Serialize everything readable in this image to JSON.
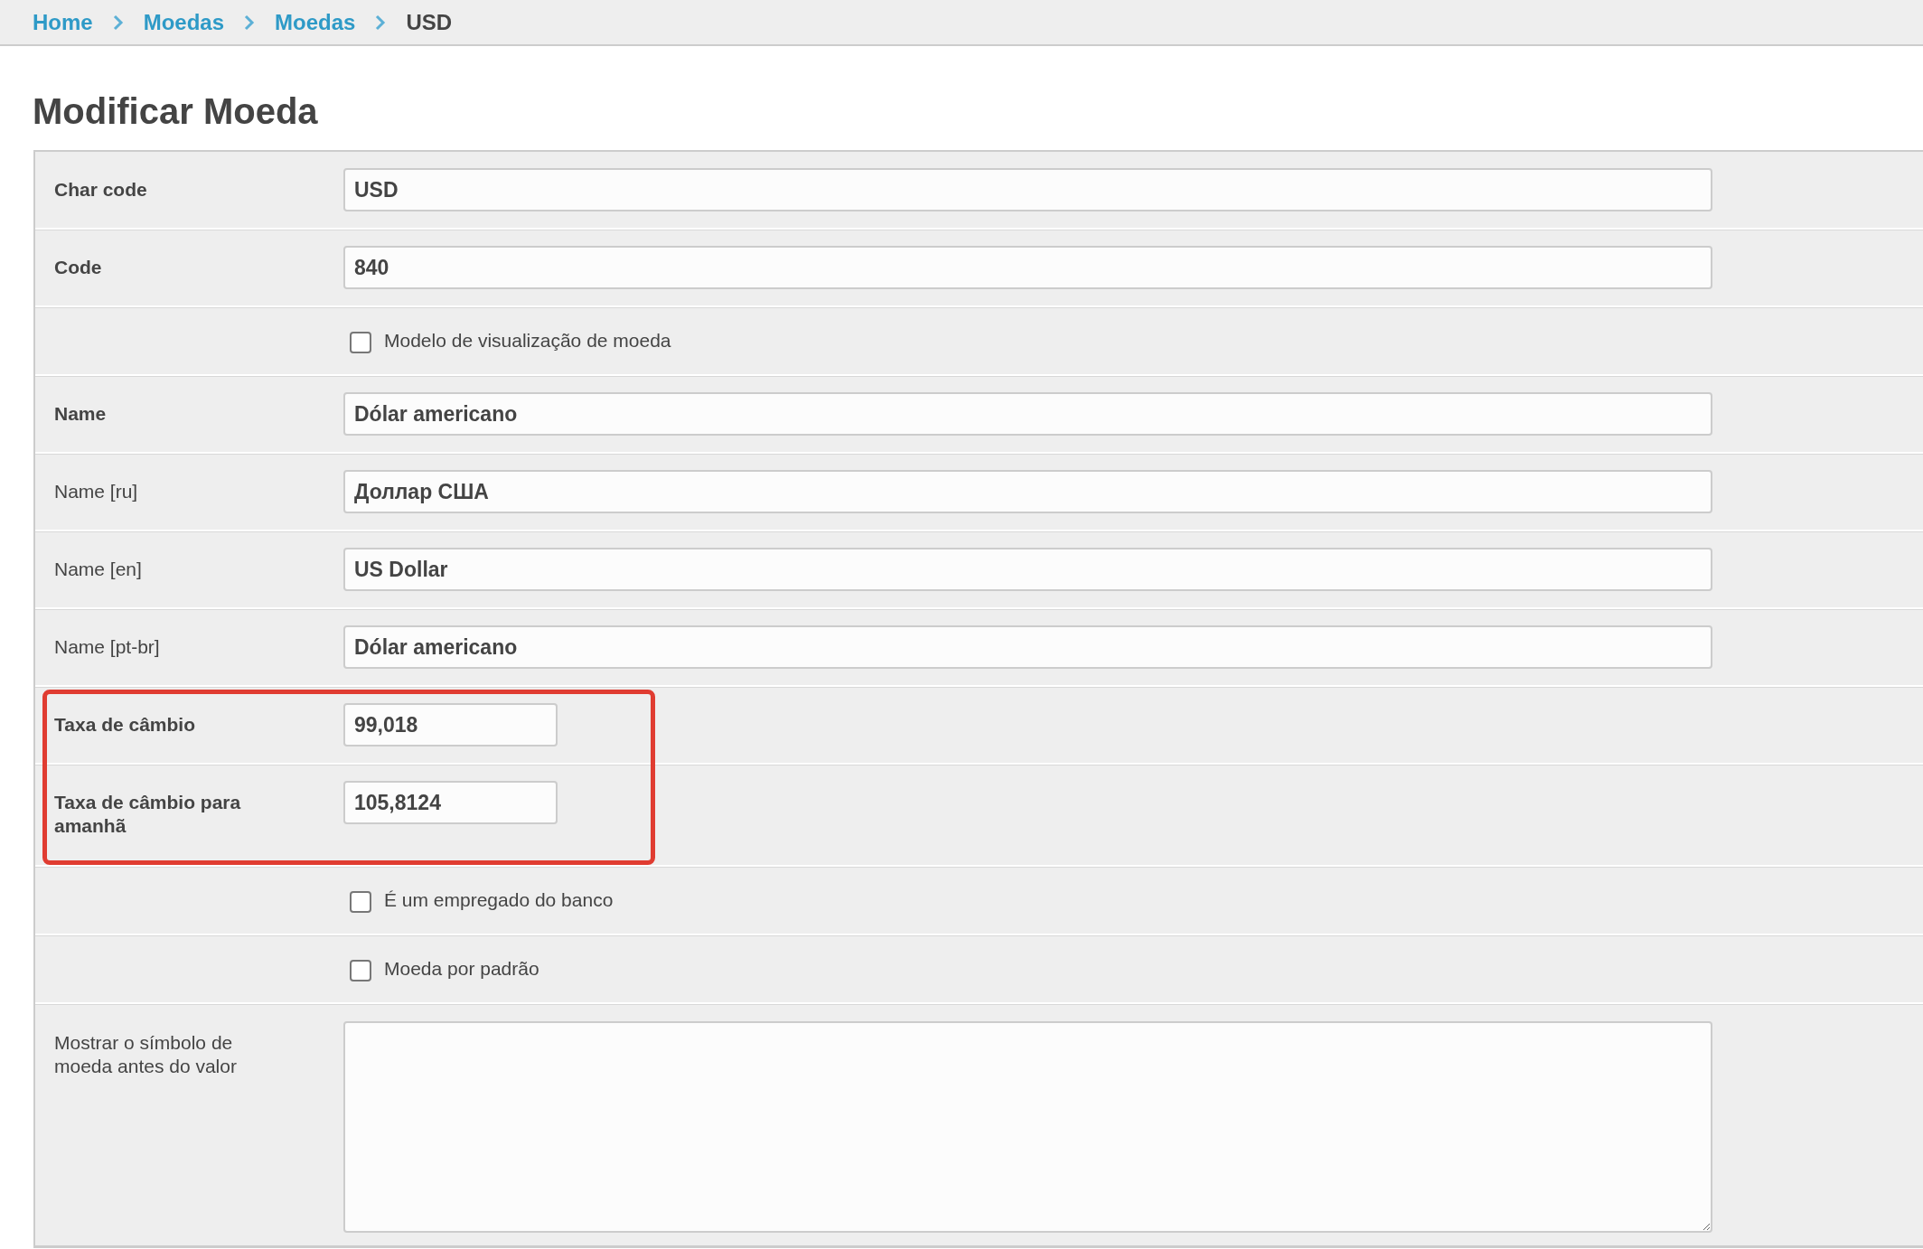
{
  "breadcrumb": [
    {
      "label": "Home",
      "current": false
    },
    {
      "label": "Moedas",
      "current": false
    },
    {
      "label": "Moedas",
      "current": false
    },
    {
      "label": "USD",
      "current": true
    }
  ],
  "title": "Modificar Moeda",
  "form": {
    "sections": [
      {
        "highlighted": false,
        "rows": [
          {
            "kind": "text",
            "label": "Char code",
            "required": true,
            "value": "USD"
          },
          {
            "kind": "text",
            "label": "Code",
            "required": true,
            "value": "840"
          },
          {
            "kind": "checkbox",
            "label": "Modelo de visualização de moeda",
            "checked": false
          },
          {
            "kind": "text",
            "label": "Name",
            "required": true,
            "value": "Dólar americano"
          },
          {
            "kind": "text",
            "label": "Name [ru]",
            "required": false,
            "value": "Доллар США"
          },
          {
            "kind": "text",
            "label": "Name [en]",
            "required": false,
            "value": "US Dollar"
          },
          {
            "kind": "text",
            "label": "Name [pt-br]",
            "required": false,
            "value": "Dólar americano"
          }
        ]
      },
      {
        "highlighted": true,
        "rows": [
          {
            "kind": "number",
            "label": "Taxa de câmbio",
            "required": true,
            "value": "99,018"
          },
          {
            "kind": "number",
            "label": "Taxa de câmbio para amanhã",
            "required": true,
            "value": "105,8124"
          }
        ]
      },
      {
        "highlighted": false,
        "rows": [
          {
            "kind": "checkbox",
            "label": "É um empregado do banco",
            "checked": false
          },
          {
            "kind": "checkbox",
            "label": "Moeda por padrão",
            "checked": false
          },
          {
            "kind": "textarea",
            "label": "Mostrar o símbolo de moeda antes do valor",
            "required": false
          }
        ]
      }
    ]
  }
}
